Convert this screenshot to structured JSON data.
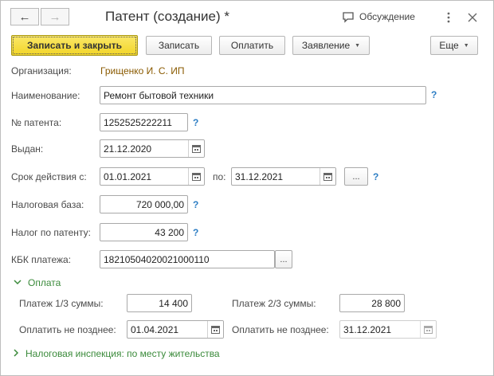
{
  "header": {
    "back_icon": "arrow-left-icon",
    "forward_icon": "arrow-right-icon",
    "title": "Патент (создание) *",
    "discuss_label": "Обсуждение",
    "more_icon": "vertical-dots-icon",
    "close_icon": "close-icon"
  },
  "toolbar": {
    "save_close_label": "Записать и закрыть",
    "save_label": "Записать",
    "pay_label": "Оплатить",
    "application_label": "Заявление",
    "more_label": "Еще"
  },
  "form": {
    "organization_label": "Организация:",
    "organization_value": "Грищенко И. С. ИП",
    "name_label": "Наименование:",
    "name_value": "Ремонт бытовой техники",
    "patent_number_label": "№ патента:",
    "patent_number_value": "1252525222211",
    "issued_label": "Выдан:",
    "issued_value": "21.12.2020",
    "validity_label": "Срок действия с:",
    "validity_from": "01.01.2021",
    "validity_to_label": "по:",
    "validity_to": "31.12.2021",
    "ellipsis": "...",
    "tax_base_label": "Налоговая база:",
    "tax_base_value": "720 000,00",
    "patent_tax_label": "Налог по патенту:",
    "patent_tax_value": "43 200",
    "kbk_label": "КБК платежа:",
    "kbk_value": "18210504020021000110",
    "help_mark": "?"
  },
  "payment": {
    "group_title": "Оплата",
    "payment1_label": "Платеж 1/3 суммы:",
    "payment1_value": "14 400",
    "payment2_label": "Платеж 2/3 суммы:",
    "payment2_value": "28 800",
    "due1_label": "Оплатить не позднее:",
    "due1_value": "01.04.2021",
    "due2_label": "Оплатить не позднее:",
    "due2_value": "31.12.2021"
  },
  "inspection": {
    "group_title": "Налоговая инспекция: по месту жительства"
  },
  "colors": {
    "primary_button": "#f2d528",
    "group_green": "#3a8a3a",
    "help_blue": "#2d7ec4",
    "org_link": "#8a5a00"
  }
}
